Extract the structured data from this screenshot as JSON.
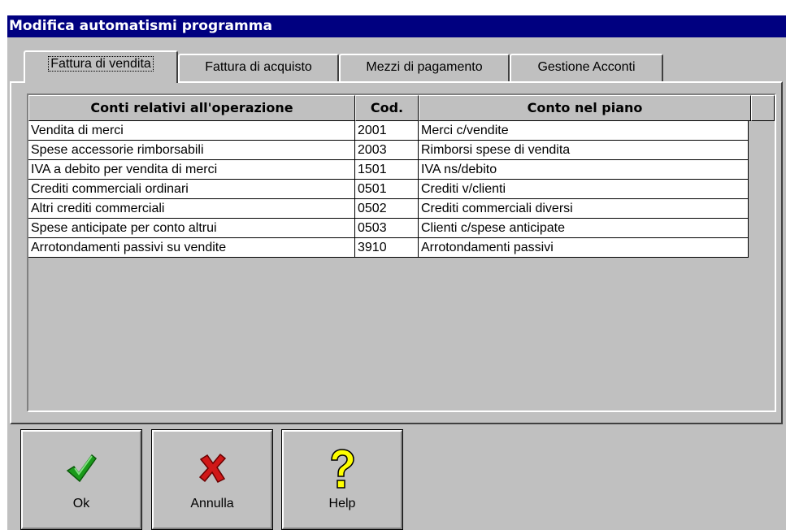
{
  "window": {
    "title": "Modifica automatismi programma"
  },
  "tabs": [
    {
      "label": "Fattura di vendita",
      "active": true
    },
    {
      "label": "Fattura di acquisto",
      "active": false
    },
    {
      "label": "Mezzi di pagamento",
      "active": false
    },
    {
      "label": "Gestione Acconti",
      "active": false
    }
  ],
  "grid": {
    "columns": [
      "Conti relativi all'operazione",
      "Cod.",
      "Conto nel piano"
    ],
    "rows": [
      [
        "Vendita di merci",
        "2001",
        "Merci c/vendite"
      ],
      [
        "Spese accessorie rimborsabili",
        "2003",
        "Rimborsi spese di vendita"
      ],
      [
        "IVA a debito per vendita di merci",
        "1501",
        "IVA ns/debito"
      ],
      [
        "Crediti commerciali ordinari",
        "0501",
        "Crediti v/clienti"
      ],
      [
        "Altri crediti commerciali",
        "0502",
        "Crediti commerciali diversi"
      ],
      [
        "Spese anticipate per conto altrui",
        "0503",
        "Clienti c/spese anticipate"
      ],
      [
        "Arrotondamenti passivi su vendite",
        "3910",
        "Arrotondamenti passivi"
      ]
    ]
  },
  "buttons": {
    "ok": {
      "label": "Ok",
      "icon": "checkmark-icon",
      "color": "#1a9a1a"
    },
    "cancel": {
      "label": "Annulla",
      "icon": "cross-icon",
      "color": "#d01818"
    },
    "help": {
      "label": "Help",
      "icon": "question-mark-icon",
      "color": "#ffff00"
    }
  },
  "colors": {
    "titlebar": "#000080",
    "face": "#c0c0c0",
    "cell": "#ffffff"
  }
}
